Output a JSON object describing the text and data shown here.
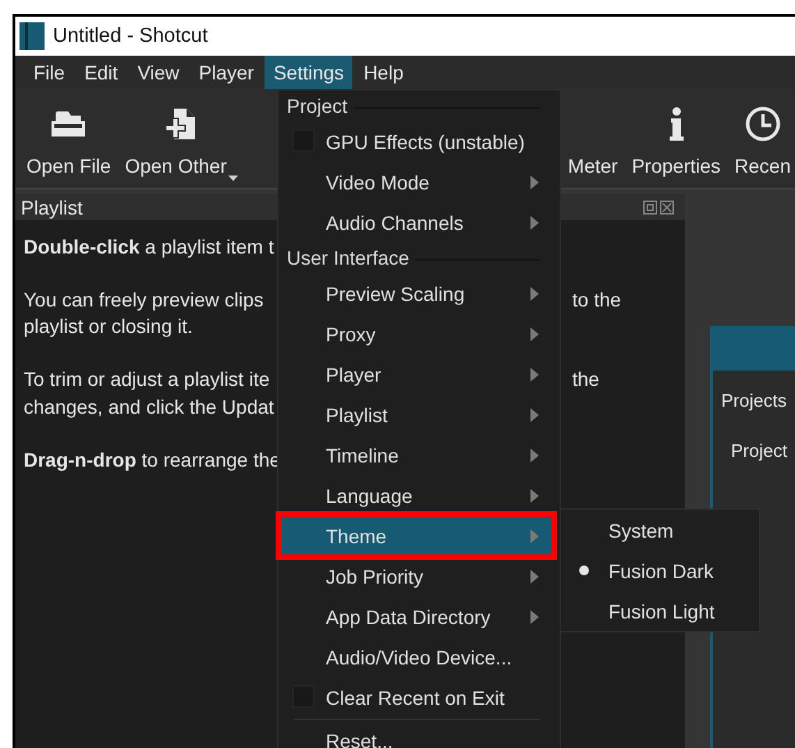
{
  "window": {
    "title": "Untitled - Shotcut"
  },
  "menubar": {
    "items": [
      {
        "label": "File",
        "selected": false
      },
      {
        "label": "Edit",
        "selected": false
      },
      {
        "label": "View",
        "selected": false
      },
      {
        "label": "Player",
        "selected": false
      },
      {
        "label": "Settings",
        "selected": true
      },
      {
        "label": "Help",
        "selected": false
      }
    ]
  },
  "toolbar": {
    "left": [
      {
        "label": "Open File",
        "dropdown": false
      },
      {
        "label": "Open Other",
        "dropdown": true
      }
    ],
    "right": [
      {
        "label": "Meter",
        "dropdown": false
      },
      {
        "label": "Properties",
        "dropdown": false
      },
      {
        "label": "Recen",
        "dropdown": false
      }
    ]
  },
  "playlist": {
    "title": "Playlist",
    "paragraphs": [
      {
        "lines": [
          {
            "left": "**Double-click** a playlist item t"
          }
        ]
      },
      {
        "lines": [
          {
            "left": "You can freely preview clips",
            "right": "to the"
          },
          {
            "left": "playlist or closing it."
          }
        ]
      },
      {
        "lines": [
          {
            "left": "To trim or adjust a playlist ite",
            "right": "the"
          },
          {
            "left": "changes, and click the Updat"
          }
        ]
      },
      {
        "lines": [
          {
            "left": "**Drag-n-drop** to rearrange the"
          }
        ]
      }
    ]
  },
  "dialog": {
    "lines": [
      "Projects",
      "Project"
    ]
  },
  "settings_menu": {
    "items": [
      {
        "kind": "section",
        "label": "Project"
      },
      {
        "kind": "checkbox",
        "label": "GPU Effects (unstable)",
        "checked": false,
        "selected": false,
        "annotated": false
      },
      {
        "kind": "submenu",
        "label": "Video Mode",
        "selected": false,
        "annotated": false
      },
      {
        "kind": "submenu",
        "label": "Audio Channels",
        "selected": false,
        "annotated": false
      },
      {
        "kind": "section",
        "label": "User Interface"
      },
      {
        "kind": "submenu",
        "label": "Preview Scaling",
        "selected": false,
        "annotated": false
      },
      {
        "kind": "submenu",
        "label": "Proxy",
        "selected": false,
        "annotated": false
      },
      {
        "kind": "submenu",
        "label": "Player",
        "selected": false,
        "annotated": false
      },
      {
        "kind": "submenu",
        "label": "Playlist",
        "selected": false,
        "annotated": false
      },
      {
        "kind": "submenu",
        "label": "Timeline",
        "selected": false,
        "annotated": false
      },
      {
        "kind": "submenu",
        "label": "Language",
        "selected": false,
        "annotated": false
      },
      {
        "kind": "submenu",
        "label": "Theme",
        "selected": true,
        "annotated": true
      },
      {
        "kind": "submenu",
        "label": "Job Priority",
        "selected": false,
        "annotated": false
      },
      {
        "kind": "submenu",
        "label": "App Data Directory",
        "selected": false,
        "annotated": false
      },
      {
        "kind": "action",
        "label": "Audio/Video Device...",
        "selected": false,
        "annotated": false
      },
      {
        "kind": "checkbox",
        "label": "Clear Recent on Exit",
        "checked": false,
        "selected": false,
        "annotated": false
      },
      {
        "kind": "separator"
      },
      {
        "kind": "action",
        "label": "Reset...",
        "selected": false,
        "annotated": false
      }
    ]
  },
  "theme_submenu": {
    "items": [
      {
        "kind": "radio",
        "label": "System",
        "checked": false,
        "selected": false,
        "annotated": false
      },
      {
        "kind": "radio",
        "label": "Fusion Dark",
        "checked": true,
        "selected": false,
        "annotated": false
      },
      {
        "kind": "radio",
        "label": "Fusion Light",
        "checked": false,
        "selected": false,
        "annotated": false
      }
    ]
  }
}
